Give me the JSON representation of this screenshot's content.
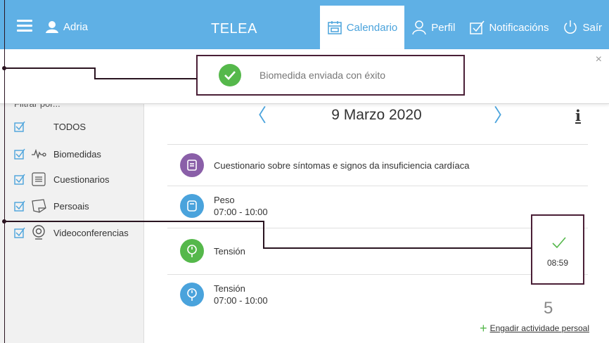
{
  "header": {
    "user_name": "Adria",
    "brand": "TELEA",
    "nav": [
      {
        "label": "Calendario",
        "icon": "calendar-icon",
        "active": true
      },
      {
        "label": "Perfil",
        "icon": "user-icon",
        "active": false
      },
      {
        "label": "Notificacións",
        "icon": "notification-icon",
        "active": false
      },
      {
        "label": "Saír",
        "icon": "power-icon",
        "active": false
      }
    ]
  },
  "toast": {
    "message": "Biomedida enviada con éxito",
    "close": "×"
  },
  "sidebar": {
    "filter_title": "Filtrar por...",
    "filters": [
      {
        "label": "TODOS",
        "checked": true,
        "icon": ""
      },
      {
        "label": "Biomedidas",
        "checked": true,
        "icon": "heartbeat-icon"
      },
      {
        "label": "Cuestionarios",
        "checked": true,
        "icon": "list-icon"
      },
      {
        "label": "Persoais",
        "checked": true,
        "icon": "note-icon"
      },
      {
        "label": "Videoconferencias",
        "checked": true,
        "icon": "webcam-icon"
      }
    ]
  },
  "calendar": {
    "date": "9 Marzo 2020",
    "prev": "〈",
    "next": "〉",
    "info": "i"
  },
  "activities": [
    {
      "title": "Cuestionario sobre síntomas e signos da insuficiencia cardíaca",
      "time": "",
      "color": "#8a5fa8",
      "icon": "questionnaire-icon"
    },
    {
      "title": "Peso",
      "time": "07:00 - 10:00",
      "color": "#4aa3dc",
      "icon": "scale-icon"
    },
    {
      "title": "Tensión",
      "time": "",
      "color": "#55b84b",
      "icon": "blood-pressure-icon",
      "done_time": "08:59"
    },
    {
      "title": "Tensión",
      "time": "07:00 - 10:00",
      "color": "#4aa3dc",
      "icon": "blood-pressure-icon"
    }
  ],
  "count": "5",
  "add_activity": {
    "plus": "+",
    "label": "Engadir actividade persoal"
  },
  "colors": {
    "header": "#5fb0e5",
    "accent": "#4aa3dc",
    "success": "#55b84b",
    "annotation": "#4a1f36"
  }
}
